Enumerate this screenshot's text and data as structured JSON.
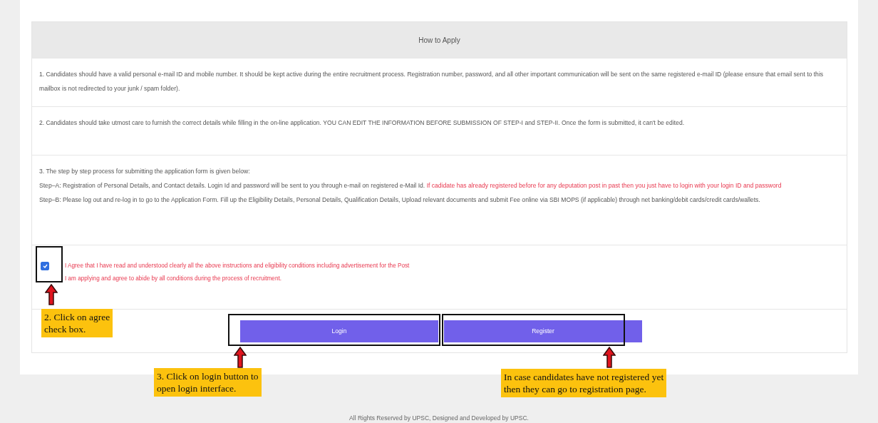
{
  "section_title": "How to Apply",
  "instructions": [
    {
      "kind": "plain",
      "lines": [
        [
          {
            "text": "1. Candidates should have a valid personal e-mail ID and mobile number. It should be kept active during the entire recruitment process. Registration number, password, and all other important communication will be sent on the same registered e-mail ID (please ensure that email sent to this mailbox is not redirected to your junk / spam folder).",
            "warning": false
          }
        ]
      ]
    },
    {
      "kind": "plain",
      "lines": [
        [
          {
            "text": "2. Candidates should take utmost care to furnish the correct details while filling in the on-line application. YOU CAN EDIT THE INFORMATION BEFORE SUBMISSION OF STEP-I and STEP-II. Once the form is submitted, it can't be edited.",
            "warning": false
          }
        ]
      ]
    },
    {
      "kind": "steps",
      "lines": [
        [
          {
            "text": "3. The step by step process for submitting the application form is given below:",
            "warning": false
          }
        ],
        [
          {
            "text": "Step–A: Registration of Personal Details, and Contact details. Login Id and password will be sent to you through e-mail on registered e-Mail Id. ",
            "warning": false
          },
          {
            "text": "If cadidate has already registered before for any deputation post in past then you just have to login with your login ID and password",
            "warning": true
          }
        ],
        [
          {
            "text": "Step–B: Please log out and re-log in to go to the Application Form. Fill up the Eligibility Details, Personal Details, Qualification Details, Upload relevant documents and submit Fee online via SBI MOPS (if applicable) through net banking/debit cards/credit cards/wallets.",
            "warning": false
          }
        ]
      ]
    }
  ],
  "agreement": {
    "checked": true,
    "lines": [
      "I Agree that I have read and understood clearly all the above instructions and eligibility conditions including advertisement for the Post",
      "I am applying and agree to abide by all conditions during the process of recruitment."
    ]
  },
  "buttons": [
    {
      "label": "Login",
      "highlighted": true
    },
    {
      "label": "Register",
      "highlighted": true
    }
  ],
  "callouts": [
    {
      "lines": [
        "2. Click on agree",
        "check box."
      ]
    },
    {
      "lines": [
        "3. Click on login button to",
        "open login interface."
      ]
    },
    {
      "lines": [
        "In case candidates have not registered yet",
        "then they can go to registration page."
      ]
    }
  ],
  "footer": "All Rights Reserved by UPSC, Designed and Developed by UPSC."
}
